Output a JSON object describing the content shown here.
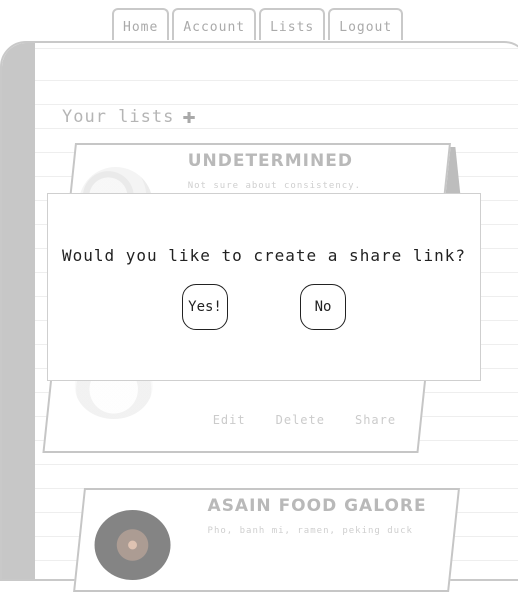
{
  "nav": {
    "tabs": [
      "Home",
      "Account",
      "Lists",
      "Logout"
    ]
  },
  "main": {
    "heading": "Your lists",
    "add_icon": "plus-icon"
  },
  "cards": [
    {
      "title": "UNDETERMINED",
      "description": "Not sure about consistency.",
      "actions": [
        "Edit",
        "Delete",
        "Share"
      ]
    },
    {
      "title": "ASAIN FOOD GALORE",
      "description": "Pho, banh mi, ramen, peking duck"
    }
  ],
  "modal": {
    "question": "Would you like to create a share link?",
    "yes_label": "Yes!",
    "no_label": "No"
  }
}
